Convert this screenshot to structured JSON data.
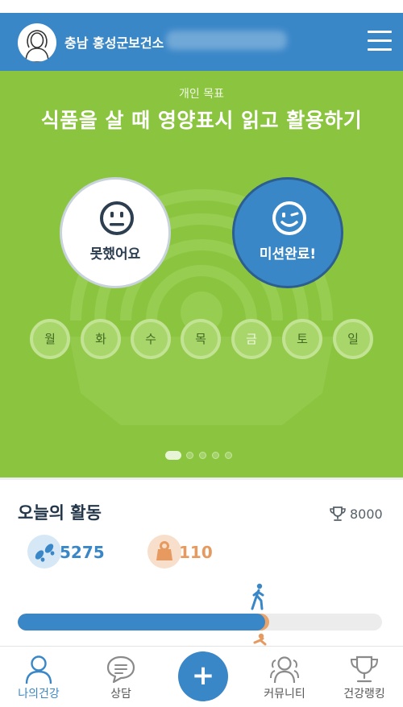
{
  "header": {
    "org_name": "충남 홍성군보건소",
    "avatar_icon": "user-avatar-icon",
    "menu_icon": "hamburger-menu-icon"
  },
  "goal": {
    "kicker": "개인 목표",
    "title": "식품을 살 때 영양표시 읽고 활용하기",
    "fail_label": "못했어요",
    "done_label": "미션완료!",
    "fail_icon": "neutral-face-icon",
    "done_icon": "winking-face-icon"
  },
  "days": [
    "월",
    "화",
    "수",
    "목",
    "금",
    "토",
    "일"
  ],
  "pager": {
    "count": 5,
    "active_index": 0
  },
  "activity": {
    "title": "오늘의 활동",
    "points": "8000",
    "steps": "5275",
    "calories": "110",
    "step_progress": 0.68,
    "calorie_progress": 0.69
  },
  "tabs": [
    {
      "label": "나의건강",
      "icon": "person-icon",
      "active": true
    },
    {
      "label": "상담",
      "icon": "chat-bubble-icon",
      "active": false
    },
    {
      "label": "커뮤니티",
      "icon": "community-icon",
      "active": false
    },
    {
      "label": "건강랭킹",
      "icon": "trophy-icon",
      "active": false
    }
  ],
  "add_label": "+",
  "colors": {
    "primary": "#3a87c8",
    "hero_green": "#8bc53f",
    "calorie_orange": "#e69a5f"
  }
}
